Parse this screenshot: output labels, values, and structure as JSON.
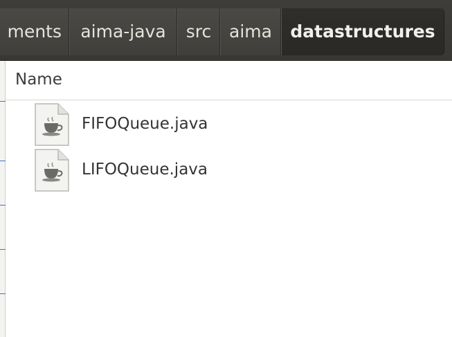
{
  "breadcrumb": {
    "segments": [
      {
        "label": "ments"
      },
      {
        "label": "aima-java"
      },
      {
        "label": "src"
      },
      {
        "label": "aima"
      },
      {
        "label": "datastructures"
      }
    ]
  },
  "file_list": {
    "column_header": "Name",
    "files": [
      {
        "name": "FIFOQueue.java",
        "icon": "java-file-icon"
      },
      {
        "name": "LIFOQueue.java",
        "icon": "java-file-icon"
      }
    ]
  },
  "colors": {
    "pathbar_bg": "#3e3d39",
    "active_crumb_bg": "#2f2e2b",
    "crumb_text": "#e6e3dc",
    "accent_tick": "#3b78c6"
  }
}
